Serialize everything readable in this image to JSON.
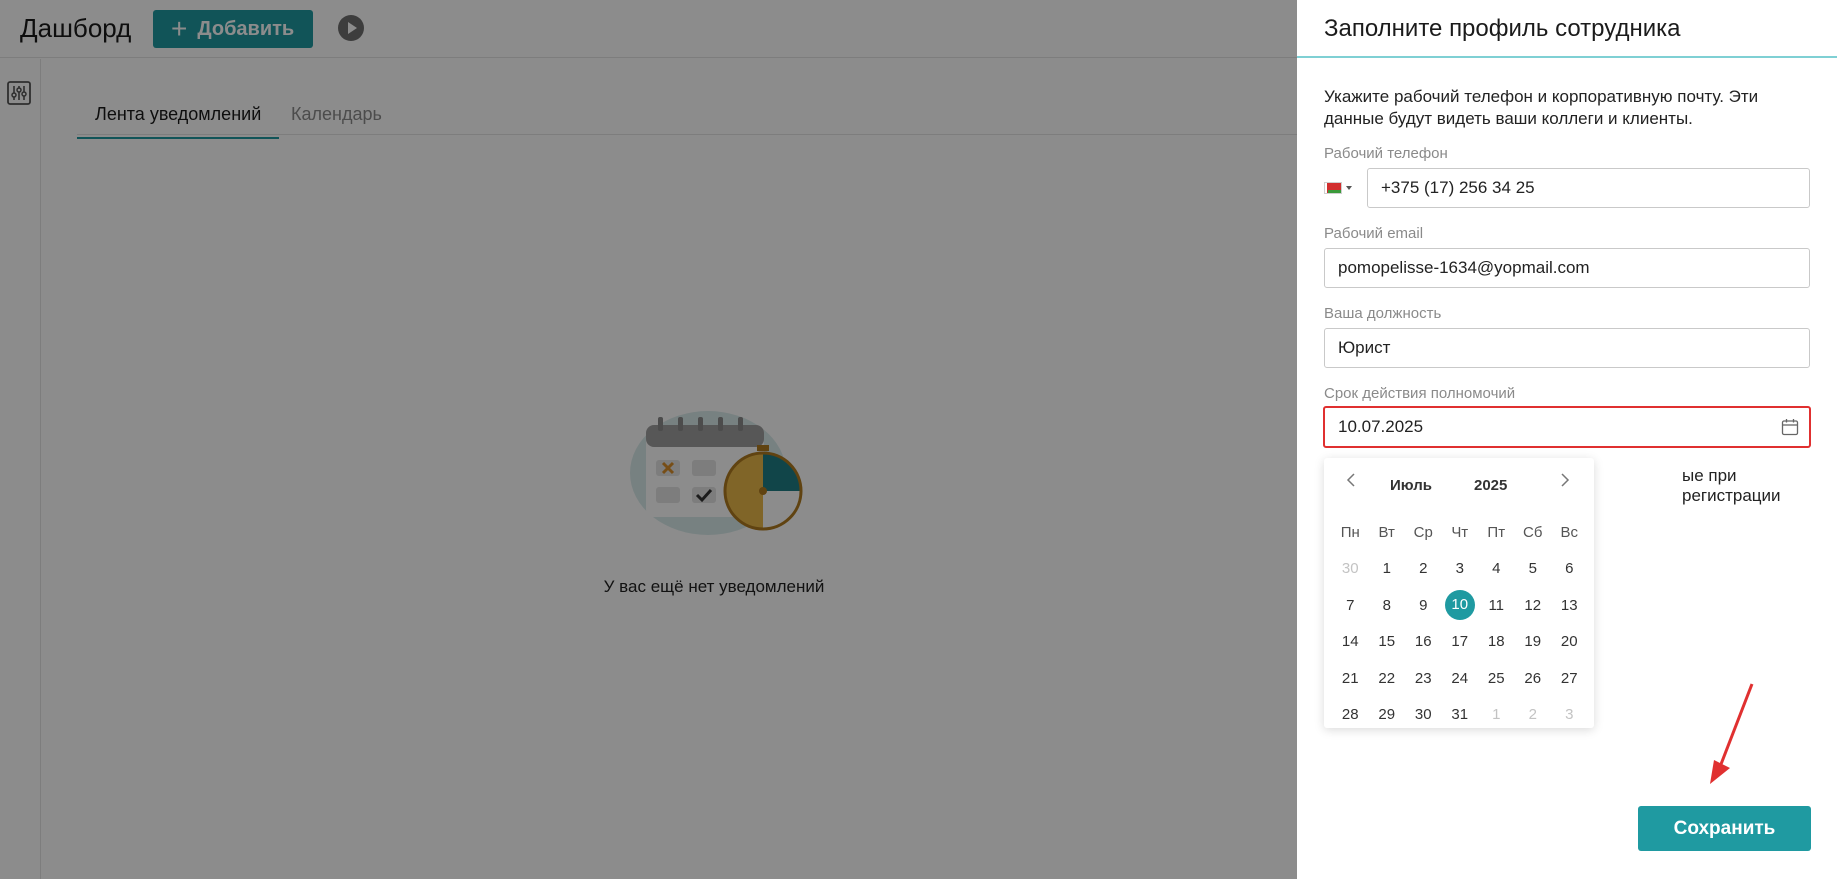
{
  "header": {
    "title": "Дашборд",
    "add_button": "Добавить"
  },
  "tabs": [
    {
      "label": "Лента уведомлений"
    },
    {
      "label": "Календарь"
    }
  ],
  "empty_state": {
    "text": "У вас ещё нет уведомлений"
  },
  "panel": {
    "title": "Заполните профиль сотрудника",
    "description": "Укажите рабочий телефон и корпоративную почту. Эти данные будут видеть ваши коллеги и клиенты.",
    "phone": {
      "label": "Рабочий телефон",
      "value": "+375 (17) 256 34 25"
    },
    "email": {
      "label": "Рабочий email",
      "value": "pomopelisse-1634@yopmail.com"
    },
    "position": {
      "label": "Ваша должность",
      "value": "Юрист"
    },
    "term": {
      "label": "Срок действия полномочий",
      "value": "10.07.2025"
    },
    "obscured_text": "ые при регистрации",
    "save_button": "Сохранить"
  },
  "datepicker": {
    "month": "Июль",
    "year": "2025",
    "weekdays": [
      "Пн",
      "Вт",
      "Ср",
      "Чт",
      "Пт",
      "Сб",
      "Вс"
    ],
    "weeks": [
      [
        "30",
        "1",
        "2",
        "3",
        "4",
        "5",
        "6"
      ],
      [
        "7",
        "8",
        "9",
        "10",
        "11",
        "12",
        "13"
      ],
      [
        "14",
        "15",
        "16",
        "17",
        "18",
        "19",
        "20"
      ],
      [
        "21",
        "22",
        "23",
        "24",
        "25",
        "26",
        "27"
      ],
      [
        "28",
        "29",
        "30",
        "31",
        "1",
        "2",
        "3"
      ]
    ],
    "selected": "10"
  },
  "colors": {
    "accent": "#1f9aa1",
    "error_border": "#e03030",
    "annotation_arrow": "#e03030"
  }
}
